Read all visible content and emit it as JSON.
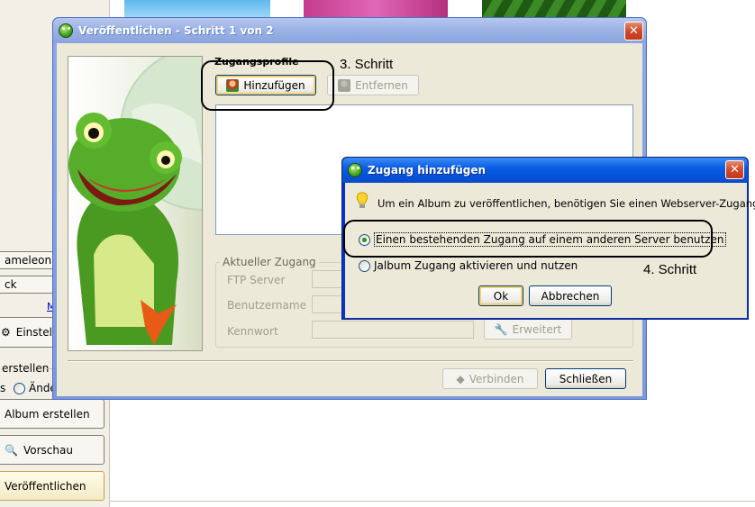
{
  "background": {
    "side_items": [
      "ameleon",
      "ck",
      "M",
      "Einstellun",
      "erstellen",
      "s",
      "Ände",
      "Album erstellen",
      "Vorschau",
      "Veröffentlichen"
    ]
  },
  "main_window": {
    "title": "Veröffentlichen - Schritt 1 von 2",
    "profiles_label": "Zugangsprofile",
    "add_button": "Hinzufügen",
    "remove_button": "Entfernen",
    "current_access_label": "Aktueller Zugang",
    "ftp_server_label": "FTP Server",
    "username_label": "Benutzername",
    "password_label": "Kennwort",
    "advanced_button": "Erweitert",
    "connect_button": "Verbinden",
    "close_button": "Schließen"
  },
  "dialog": {
    "title": "Zugang hinzufügen",
    "info_text": "Um ein Album zu veröffentlichen, benötigen Sie einen Webserver-Zugang",
    "option_existing": "Einen bestehenden Zugang auf einem anderen Server benutzen",
    "option_jalbum": "Jalbum Zugang aktivieren und nutzen",
    "selected_option": "existing",
    "ok_button": "Ok",
    "cancel_button": "Abbrechen"
  },
  "annotations": {
    "step3": "3. Schritt",
    "step4": "4. Schritt"
  }
}
